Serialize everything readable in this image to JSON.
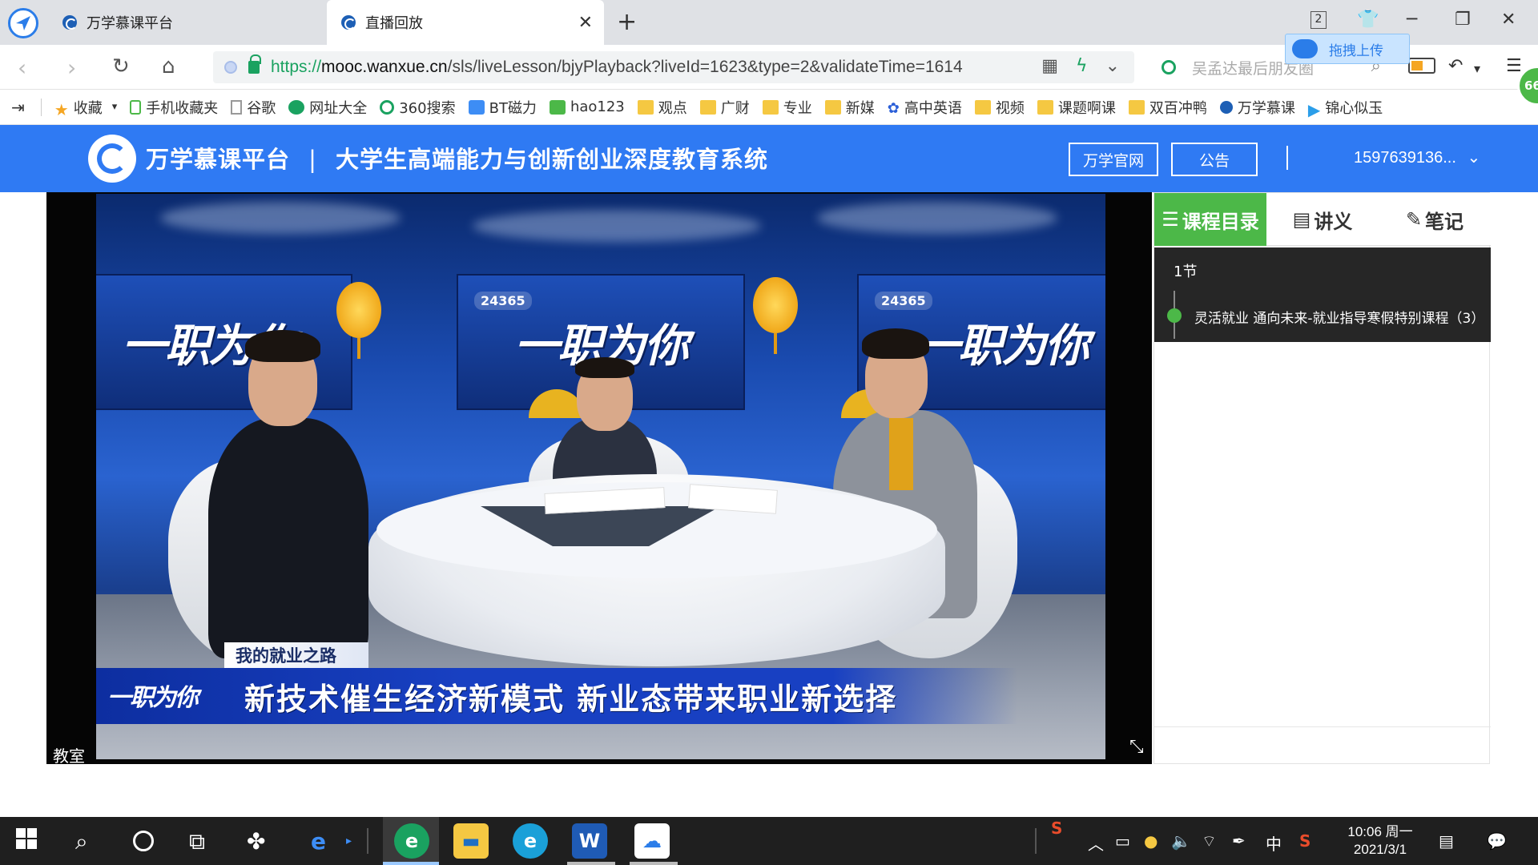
{
  "browser": {
    "tabs": [
      {
        "label": "万学慕课平台"
      },
      {
        "label": "直播回放"
      }
    ],
    "tab_count": "2",
    "address": {
      "scheme": "https://",
      "host": "mooc.wanxue.cn",
      "path": "/sls/liveLesson/bjyPlayback?liveId=1623&type=2&validateTime=1614"
    },
    "search_placeholder": "吴孟达最后朋友圈",
    "cloud_upload_label": "拖拽上传",
    "avatar_badge": "66"
  },
  "bookmarks": [
    {
      "label": "收藏",
      "icon": "star-icon"
    },
    {
      "label": "手机收藏夹",
      "icon": "phone-icon"
    },
    {
      "label": "谷歌",
      "icon": "document-icon"
    },
    {
      "label": "网址大全",
      "icon": "site-icon"
    },
    {
      "label": "360搜索",
      "icon": "search-ring-icon"
    },
    {
      "label": "BT磁力",
      "icon": "bt-icon"
    },
    {
      "label": "hao123",
      "icon": "hao123-icon"
    },
    {
      "label": "观点",
      "icon": "folder-icon"
    },
    {
      "label": "广财",
      "icon": "folder-icon"
    },
    {
      "label": "专业",
      "icon": "folder-icon"
    },
    {
      "label": "新媒",
      "icon": "folder-icon"
    },
    {
      "label": "高中英语",
      "icon": "paw-icon"
    },
    {
      "label": "视频",
      "icon": "folder-icon"
    },
    {
      "label": "课题啊课",
      "icon": "folder-icon"
    },
    {
      "label": "双百冲鸭",
      "icon": "folder-icon"
    },
    {
      "label": "万学慕课",
      "icon": "site-icon"
    },
    {
      "label": "锦心似玉",
      "icon": "play-icon"
    }
  ],
  "site": {
    "brand": "万学慕课平台",
    "subtitle": "大学生高端能力与创新创业深度教育系统",
    "official_site_button": "万学官网",
    "notice_button": "公告",
    "user": "1597639136..."
  },
  "video": {
    "studio_brand": "一职为你",
    "studio_badge": "24365",
    "tag": "我的就业之路",
    "caption": "新技术催生经济新模式 新业态带来职业新选择",
    "lower_logo": "一职为你",
    "label": "教室"
  },
  "side_panel": {
    "tabs": {
      "catalog": "课程目录",
      "handout": "讲义",
      "notes": "笔记"
    },
    "section": "1节",
    "lesson": "灵活就业 通向未来-就业指导寒假特别课程（3）"
  },
  "taskbar": {
    "clock_time": "10:06 周一",
    "clock_date": "2021/3/1",
    "ime": "中"
  },
  "colors": {
    "header_blue": "#2f7af3",
    "catalog_green": "#4cb848",
    "catalog_dark": "#262626",
    "taskbar": "#1f1f1f"
  }
}
